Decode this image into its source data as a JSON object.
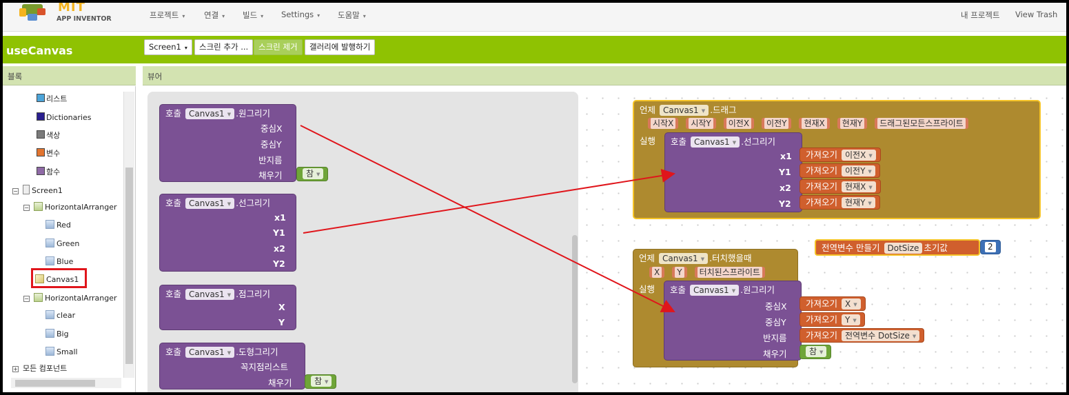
{
  "app": {
    "logo_title": "MIT",
    "logo_subtitle": "APP INVENTOR"
  },
  "menu": {
    "project": "프로젝트",
    "connect": "연결",
    "build": "빌드",
    "settings": "Settings",
    "help": "도움말",
    "my_projects": "내 프로젝트",
    "view_trash": "View Trash"
  },
  "toolbar": {
    "project_name": "useCanvas",
    "screen_select": "Screen1",
    "add_screen": "스크린 추가 ...",
    "remove_screen": "스크린 제거",
    "publish_gallery": "갤러리에 발행하기"
  },
  "panels": {
    "blocks": "블록",
    "viewer": "뷰어"
  },
  "tree": {
    "builtins": [
      {
        "label": "리스트",
        "color": "#4ca4d9"
      },
      {
        "label": "Dictionaries",
        "color": "#2a1f8f"
      },
      {
        "label": "색상",
        "color": "#7a7a7a"
      },
      {
        "label": "변수",
        "color": "#e27530"
      },
      {
        "label": "함수",
        "color": "#8f6aa6"
      }
    ],
    "screen": "Screen1",
    "arranger1": "HorizontalArranger",
    "arranger1_children": [
      "Red",
      "Green",
      "Blue"
    ],
    "canvas": "Canvas1",
    "arranger2": "HorizontalArranger",
    "arranger2_children": [
      "clear",
      "Big",
      "Small"
    ],
    "all_components": "모든 컴포넌트"
  },
  "blocks": {
    "call": "호출",
    "when": "언제",
    "do": "실행",
    "get": "가져오기",
    "component": "Canvas1",
    "draw_circle": ".원그리기",
    "draw_line": ".선그리기",
    "draw_point": ".점그리기",
    "draw_shape": ".도형그리기",
    "drag_event": ".드래그",
    "touched_event": ".터치했을때",
    "center_x": "중심X",
    "center_y": "중심Y",
    "radius": "반지름",
    "fill": "채우기",
    "x1": "x1",
    "y1": "Y1",
    "x2": "x2",
    "y2": "Y2",
    "x1_cap": "X1",
    "y2_cap": "Y2",
    "x": "X",
    "y": "Y",
    "point_list": "꼭지점리스트",
    "true_val": "참",
    "drag_params": [
      "시작X",
      "시작Y",
      "이전X",
      "이전Y",
      "현재X",
      "현재Y",
      "드래그된모든스프라이트"
    ],
    "touch_params": [
      "X",
      "Y",
      "터치된스프라이트"
    ],
    "prev_x": "이전X",
    "prev_y": "이전Y",
    "cur_x": "현재X",
    "cur_y": "현재Y",
    "global_var": "전역변수",
    "make": "만들기",
    "dot_size": "DotSize",
    "init_value": "초기값",
    "number_two": "2",
    "global_dotsize": "전역변수 DotSize"
  }
}
